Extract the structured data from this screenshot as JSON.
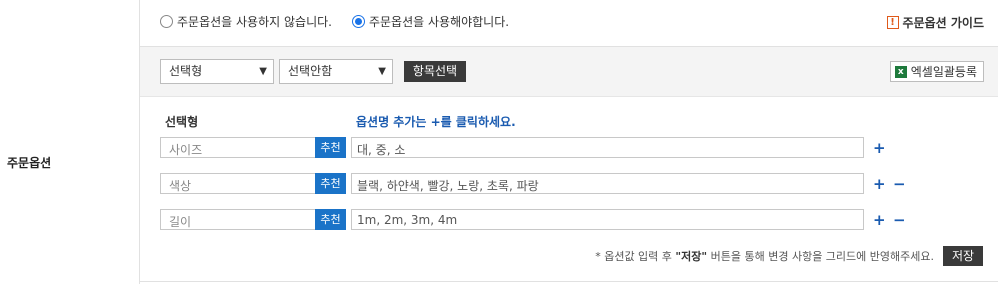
{
  "left": {
    "label": "주문옵션"
  },
  "radio_options": [
    {
      "label": "주문옵션을 사용하지 않습니다.",
      "checked": false
    },
    {
      "label": "주문옵션을 사용해야합니다.",
      "checked": true
    }
  ],
  "guide": {
    "icon": "!",
    "label": "주문옵션 가이드"
  },
  "toolbar": {
    "type_select": "선택형",
    "required_select": "선택안함",
    "item_select_button": "항목선택",
    "excel_icon": "x",
    "excel_button": "엑셀일괄등록"
  },
  "columns": {
    "type_header": "선택형",
    "option_header": "옵션명 추가는 +를 클릭하세요."
  },
  "rows": [
    {
      "name": "사이즈",
      "recommend": "추천",
      "values": "대, 중, 소",
      "show_minus": false
    },
    {
      "name": "색상",
      "recommend": "추천",
      "values": "블랙, 하얀색, 빨강, 노랑, 초록, 파랑",
      "show_minus": true
    },
    {
      "name": "길이",
      "recommend": "추천",
      "values": "1m, 2m, 3m, 4m",
      "show_minus": true
    }
  ],
  "footer": {
    "hint_prefix": "* 옵션값 입력 후 ",
    "hint_bold": "\"저장\"",
    "hint_suffix": " 버튼을 통해 변경 사항을 그리드에 반영해주세요.",
    "save_button": "저장"
  },
  "colors": {
    "accent_blue": "#1a73c8",
    "header_blue": "#1a5bb0",
    "dark_button": "#3a3a3a",
    "guide_icon": "#e05a1a",
    "excel_green": "#1e7a3c"
  }
}
